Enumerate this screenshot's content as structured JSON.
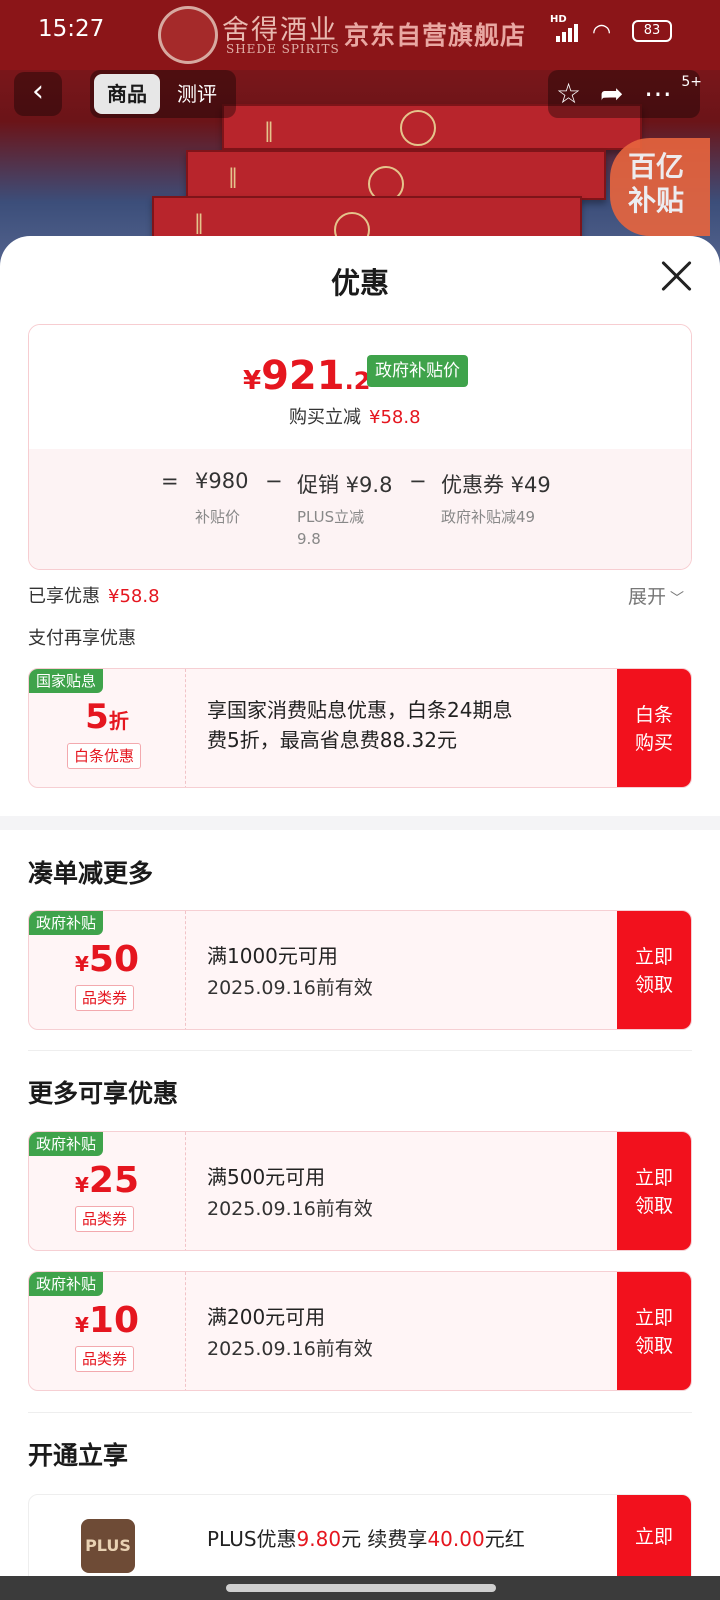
{
  "status_bar": {
    "time": "15:27",
    "network": "HD",
    "battery": "83"
  },
  "store_header": {
    "brand_cn": "舍得酒业",
    "brand_en": "SHEDE SPIRITS",
    "store_name": "京东自营旗舰店",
    "subsidy_badge": "百亿补贴"
  },
  "nav": {
    "back_icon": "chevron-left-icon",
    "tabs": [
      {
        "label": "商品"
      },
      {
        "label": "测评"
      }
    ],
    "actions": [
      "star-icon",
      "share-icon",
      "more-icon"
    ],
    "more_badge": "5+"
  },
  "sheet": {
    "title": "优惠",
    "price": {
      "yen": "¥",
      "integer": "921",
      "decimal": ".2",
      "tag": "政府补贴价",
      "sub_label": "购买立减",
      "sub_value": "¥58.8",
      "eq": "=",
      "minus": "−",
      "items": [
        {
          "value": "¥980",
          "label": "补贴价"
        },
        {
          "value": "促销 ¥9.8",
          "label_line1": "PLUS立减",
          "label_line2": "9.8"
        },
        {
          "value": "优惠券 ¥49",
          "label": "政府补贴减49"
        }
      ]
    },
    "enjoyed": {
      "label": "已享优惠",
      "value": "¥58.8",
      "expand": "展开"
    },
    "pay_more": "支付再享优惠",
    "installment": {
      "tag": "国家贴息",
      "amount": "5",
      "unit": "折",
      "kind": "白条优惠",
      "desc_line1": "享国家消费贴息优惠，白条24期息",
      "desc_line2": "费5折，最高省息费88.32元",
      "button_line1": "白条",
      "button_line2": "购买"
    },
    "sections": [
      {
        "title": "凑单减更多"
      },
      {
        "title": "更多可享优惠"
      },
      {
        "title": "开通立享"
      }
    ],
    "coupons": [
      {
        "tag": "政府补贴",
        "sym": "¥",
        "amount": "50",
        "kind": "品类券",
        "condition": "满1000元可用",
        "expiry": "2025.09.16前有效",
        "button_line1": "立即",
        "button_line2": "领取"
      },
      {
        "tag": "政府补贴",
        "sym": "¥",
        "amount": "25",
        "kind": "品类券",
        "condition": "满500元可用",
        "expiry": "2025.09.16前有效",
        "button_line1": "立即",
        "button_line2": "领取"
      },
      {
        "tag": "政府补贴",
        "sym": "¥",
        "amount": "10",
        "kind": "品类券",
        "condition": "满200元可用",
        "expiry": "2025.09.16前有效",
        "button_line1": "立即",
        "button_line2": "领取"
      }
    ],
    "plus": {
      "logo": "PLUS",
      "text_a": "PLUS优惠",
      "value_a": "9.80",
      "text_b": "元 续费享",
      "value_b": "40.00",
      "text_c": "元红",
      "button": "立即"
    }
  },
  "colors": {
    "accent_red": "#f2111d",
    "price_red": "#e5161f",
    "tag_green": "#3fa34b"
  }
}
